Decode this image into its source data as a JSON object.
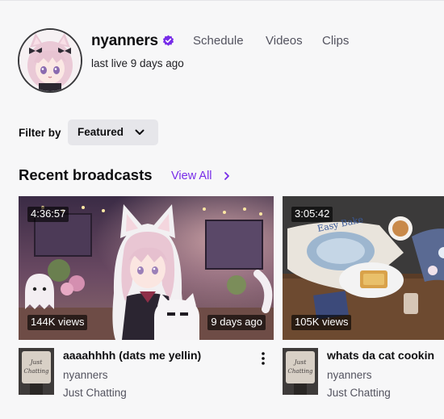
{
  "channel": {
    "name": "nyanners",
    "verified_icon": "verified-badge-icon",
    "last_live": "last live 9 days ago",
    "accent_color": "#772ce8",
    "tabs": [
      {
        "label": "Schedule"
      },
      {
        "label": "Videos"
      },
      {
        "label": "Clips"
      }
    ]
  },
  "filter": {
    "label": "Filter by",
    "selected": "Featured"
  },
  "section": {
    "title": "Recent broadcasts",
    "view_all": "View All"
  },
  "videos": [
    {
      "duration": "4:36:57",
      "views": "144K views",
      "age": "9 days ago",
      "title": "aaaahhhh (dats me yellin)",
      "channel": "nyanners",
      "category": "Just Chatting"
    },
    {
      "duration": "3:05:42",
      "views": "105K views",
      "title": "whats da cat cookin",
      "channel": "nyanners",
      "category": "Just Chatting"
    }
  ],
  "category_art_text": "Just Chatting"
}
